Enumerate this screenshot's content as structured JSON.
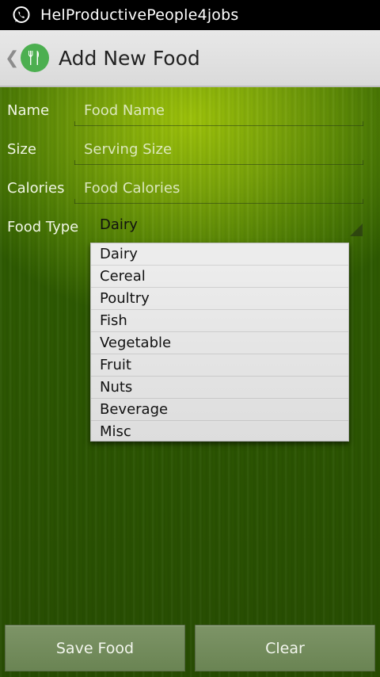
{
  "status_bar": {
    "title": "HelProductivePeople4jobs",
    "icon": "whatsapp-icon"
  },
  "action_bar": {
    "back_icon": "chevron-left-icon",
    "app_icon": "fork-knife-icon",
    "title": "Add New Food"
  },
  "form": {
    "name": {
      "label": "Name",
      "placeholder": "Food Name"
    },
    "size": {
      "label": "Size",
      "placeholder": "Serving Size"
    },
    "calories": {
      "label": "Calories",
      "placeholder": "Food Calories"
    },
    "food_type": {
      "label": "Food Type",
      "selected": "Dairy"
    }
  },
  "dropdown": {
    "options": [
      "Dairy",
      "Cereal",
      "Poultry",
      "Fish",
      "Vegetable",
      "Fruit",
      "Nuts",
      "Beverage",
      "Misc"
    ]
  },
  "buttons": {
    "save": "Save Food",
    "clear": "Clear"
  },
  "colors": {
    "app_icon_bg": "#4caf50",
    "background_green": "#7aa30a"
  }
}
